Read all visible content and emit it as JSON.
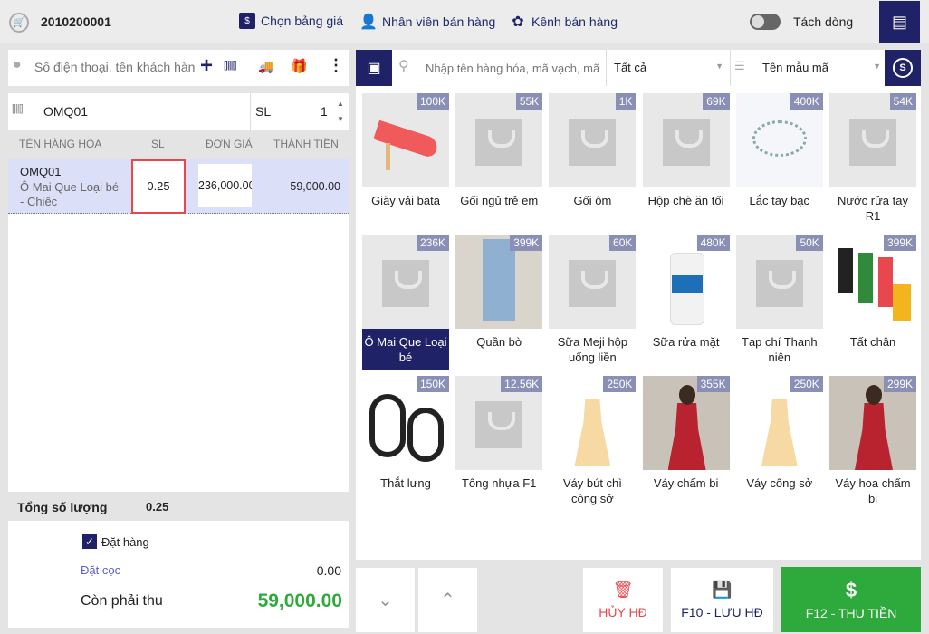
{
  "header": {
    "invoice_code": "2010200001",
    "price_list": "Chọn bảng giá",
    "staff": "Nhân viên bán hàng",
    "channel": "Kênh bán hàng",
    "split_line": "Tách dòng"
  },
  "customer": {
    "placeholder": "Số điện thoại, tên khách hàng"
  },
  "barcode": {
    "value": "OMQ01",
    "qty_label": "SL",
    "qty_value": "1"
  },
  "cart": {
    "headers": [
      "TÊN HÀNG HÓA",
      "SL",
      "ĐƠN GIÁ",
      "THÀNH TIỀN"
    ],
    "rows": [
      {
        "code": "OMQ01",
        "name": "Ô Mai Que Loại bé",
        "unit": "- Chiếc",
        "qty": "0.25",
        "price": "236,000.00",
        "total": "59,000.00"
      }
    ]
  },
  "summary": {
    "total_qty_label": "Tổng số lượng",
    "total_qty": "0.25",
    "order_label": "Đặt hàng",
    "deposit_label": "Đặt cọc",
    "deposit": "0.00",
    "remaining_label": "Còn phải thu",
    "remaining": "59,000.00"
  },
  "search": {
    "placeholder": "Nhập tên hàng hóa, mã vạch, mã",
    "category": "Tất cả",
    "sort": "Tên mẫu mã"
  },
  "products": [
    {
      "name": "Giày vải bata",
      "price": "100K",
      "img": "shoe"
    },
    {
      "name": "Gối ngủ trẻ em",
      "price": "55K",
      "img": "bag"
    },
    {
      "name": "Gối ôm",
      "price": "1K",
      "img": "bag"
    },
    {
      "name": "Hộp chè ăn tối",
      "price": "69K",
      "img": "bag"
    },
    {
      "name": "Lắc tay bạc",
      "price": "400K",
      "img": "bracelet"
    },
    {
      "name": "Nước rửa tay R1",
      "price": "54K",
      "img": "bag"
    },
    {
      "name": "Ô Mai Que Loại bé",
      "price": "236K",
      "img": "bag",
      "selected": true
    },
    {
      "name": "Quần bò",
      "price": "399K",
      "img": "jeans"
    },
    {
      "name": "Sữa Meji hộp uống liền",
      "price": "60K",
      "img": "bag"
    },
    {
      "name": "Sữa rửa mặt",
      "price": "480K",
      "img": "bottle"
    },
    {
      "name": "Tạp chí Thanh niên",
      "price": "50K",
      "img": "bag"
    },
    {
      "name": "Tất chân",
      "price": "399K",
      "img": "socks"
    },
    {
      "name": "Thắt lưng",
      "price": "150K",
      "img": "belt"
    },
    {
      "name": "Tông nhựa F1",
      "price": "12.56K",
      "img": "bag"
    },
    {
      "name": "Váy bút chì công sở",
      "price": "250K",
      "img": "dress"
    },
    {
      "name": "Váy chấm bi",
      "price": "355K",
      "img": "reddress"
    },
    {
      "name": "Váy công sở",
      "price": "250K",
      "img": "dress"
    },
    {
      "name": "Váy hoa chấm bi",
      "price": "299K",
      "img": "reddress"
    }
  ],
  "actions": {
    "cancel": "HỦY HĐ",
    "save": "F10 - LƯU HĐ",
    "pay": "F12 - THU TIỀN"
  },
  "colors": {
    "navy": "#1f2266",
    "green": "#2eaa3c",
    "red": "#e9474e"
  }
}
